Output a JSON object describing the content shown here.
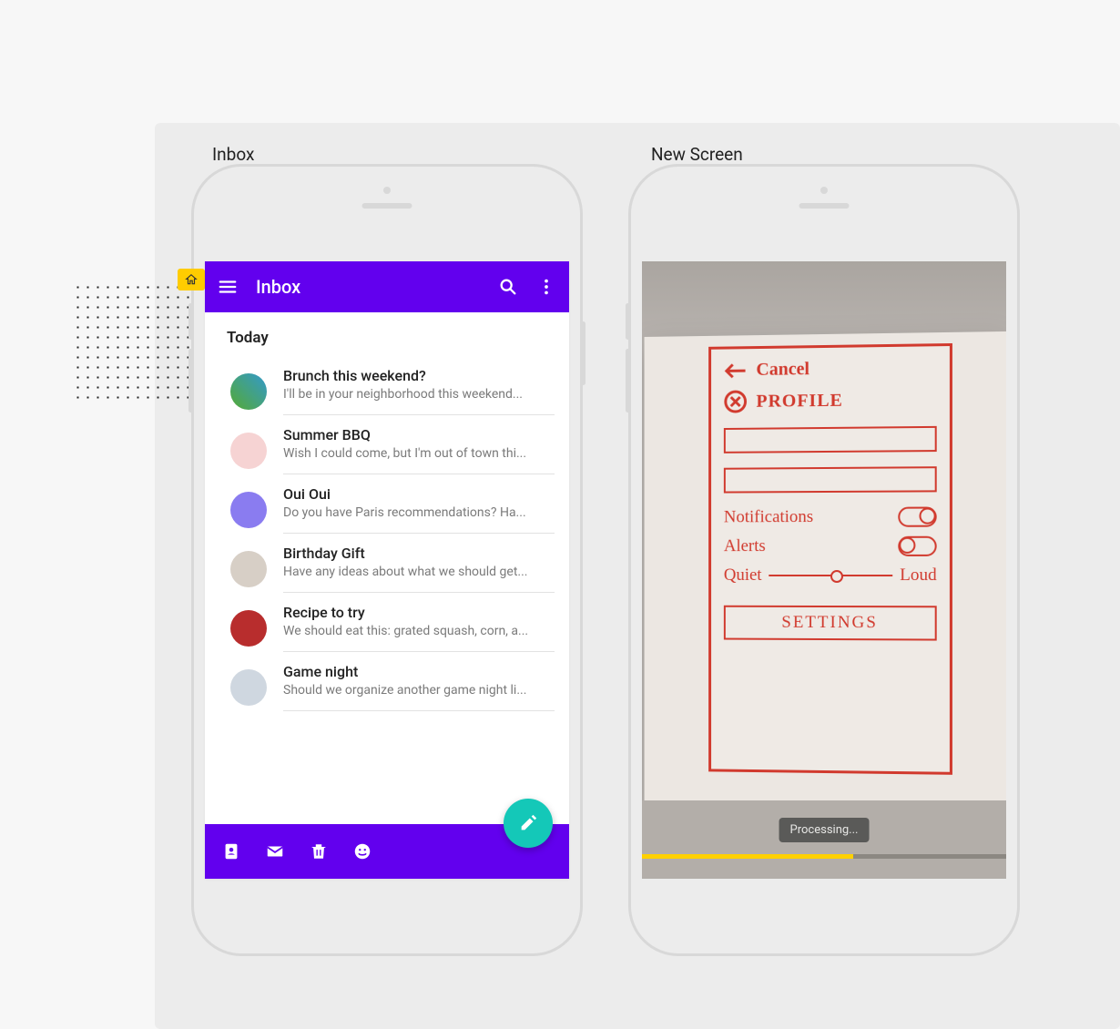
{
  "colors": {
    "primary": "#6200ee",
    "accent": "#14c8b8",
    "home_tag": "#ffcc00",
    "sketch_ink": "#d13a2e",
    "progress_fill": "#ffd100"
  },
  "left_phone": {
    "frame_label": "Inbox",
    "appbar": {
      "title": "Inbox"
    },
    "section_header": "Today",
    "messages": [
      {
        "title": "Brunch this weekend?",
        "subtitle": "I'll be in your neighborhood this weekend..."
      },
      {
        "title": "Summer BBQ",
        "subtitle": "Wish I could come, but I'm out of town thi..."
      },
      {
        "title": "Oui Oui",
        "subtitle": "Do you have Paris recommendations? Ha..."
      },
      {
        "title": "Birthday Gift",
        "subtitle": "Have any ideas about what we should get..."
      },
      {
        "title": "Recipe to try",
        "subtitle": "We should eat this: grated squash, corn, a..."
      },
      {
        "title": "Game night",
        "subtitle": "Should we organize another game night li..."
      }
    ],
    "bottom_icons": [
      "contacts-icon",
      "mail-icon",
      "trash-icon",
      "emoji-icon"
    ],
    "fab_icon": "compose-icon"
  },
  "right_phone": {
    "frame_label": "New Screen",
    "sketch": {
      "back_label": "Cancel",
      "title": "PROFILE",
      "options": [
        {
          "label": "Notifications",
          "type": "toggle",
          "state": "on"
        },
        {
          "label": "Alerts",
          "type": "toggle",
          "state": "off"
        }
      ],
      "slider": {
        "min_label": "Quiet",
        "max_label": "Loud"
      },
      "button_label": "SETTINGS"
    },
    "processing_label": "Processing...",
    "progress_percent": 58
  }
}
